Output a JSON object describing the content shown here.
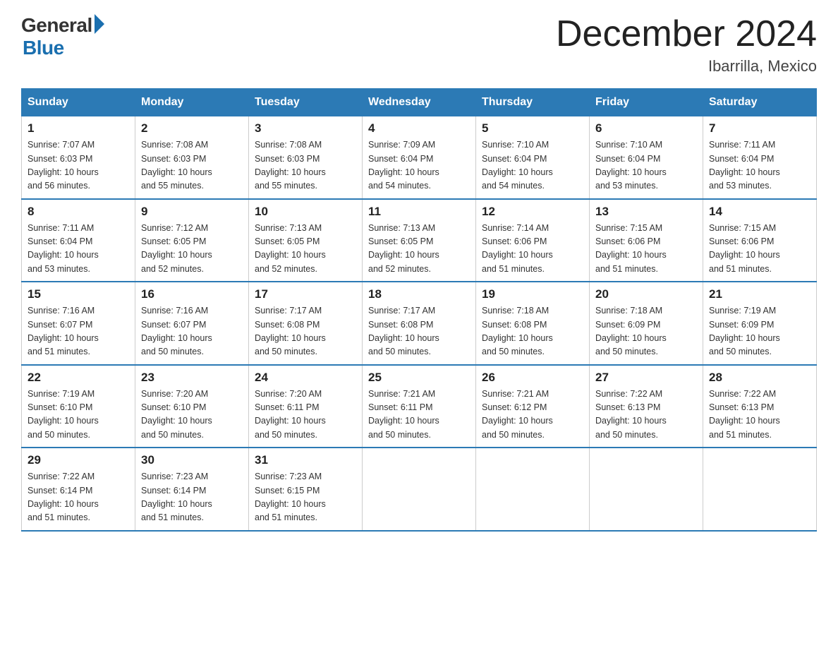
{
  "header": {
    "logo_general": "General",
    "logo_blue": "Blue",
    "title": "December 2024",
    "subtitle": "Ibarrilla, Mexico"
  },
  "days_of_week": [
    "Sunday",
    "Monday",
    "Tuesday",
    "Wednesday",
    "Thursday",
    "Friday",
    "Saturday"
  ],
  "weeks": [
    [
      {
        "day": "1",
        "sunrise": "7:07 AM",
        "sunset": "6:03 PM",
        "daylight": "10 hours and 56 minutes."
      },
      {
        "day": "2",
        "sunrise": "7:08 AM",
        "sunset": "6:03 PM",
        "daylight": "10 hours and 55 minutes."
      },
      {
        "day": "3",
        "sunrise": "7:08 AM",
        "sunset": "6:03 PM",
        "daylight": "10 hours and 55 minutes."
      },
      {
        "day": "4",
        "sunrise": "7:09 AM",
        "sunset": "6:04 PM",
        "daylight": "10 hours and 54 minutes."
      },
      {
        "day": "5",
        "sunrise": "7:10 AM",
        "sunset": "6:04 PM",
        "daylight": "10 hours and 54 minutes."
      },
      {
        "day": "6",
        "sunrise": "7:10 AM",
        "sunset": "6:04 PM",
        "daylight": "10 hours and 53 minutes."
      },
      {
        "day": "7",
        "sunrise": "7:11 AM",
        "sunset": "6:04 PM",
        "daylight": "10 hours and 53 minutes."
      }
    ],
    [
      {
        "day": "8",
        "sunrise": "7:11 AM",
        "sunset": "6:04 PM",
        "daylight": "10 hours and 53 minutes."
      },
      {
        "day": "9",
        "sunrise": "7:12 AM",
        "sunset": "6:05 PM",
        "daylight": "10 hours and 52 minutes."
      },
      {
        "day": "10",
        "sunrise": "7:13 AM",
        "sunset": "6:05 PM",
        "daylight": "10 hours and 52 minutes."
      },
      {
        "day": "11",
        "sunrise": "7:13 AM",
        "sunset": "6:05 PM",
        "daylight": "10 hours and 52 minutes."
      },
      {
        "day": "12",
        "sunrise": "7:14 AM",
        "sunset": "6:06 PM",
        "daylight": "10 hours and 51 minutes."
      },
      {
        "day": "13",
        "sunrise": "7:15 AM",
        "sunset": "6:06 PM",
        "daylight": "10 hours and 51 minutes."
      },
      {
        "day": "14",
        "sunrise": "7:15 AM",
        "sunset": "6:06 PM",
        "daylight": "10 hours and 51 minutes."
      }
    ],
    [
      {
        "day": "15",
        "sunrise": "7:16 AM",
        "sunset": "6:07 PM",
        "daylight": "10 hours and 51 minutes."
      },
      {
        "day": "16",
        "sunrise": "7:16 AM",
        "sunset": "6:07 PM",
        "daylight": "10 hours and 50 minutes."
      },
      {
        "day": "17",
        "sunrise": "7:17 AM",
        "sunset": "6:08 PM",
        "daylight": "10 hours and 50 minutes."
      },
      {
        "day": "18",
        "sunrise": "7:17 AM",
        "sunset": "6:08 PM",
        "daylight": "10 hours and 50 minutes."
      },
      {
        "day": "19",
        "sunrise": "7:18 AM",
        "sunset": "6:08 PM",
        "daylight": "10 hours and 50 minutes."
      },
      {
        "day": "20",
        "sunrise": "7:18 AM",
        "sunset": "6:09 PM",
        "daylight": "10 hours and 50 minutes."
      },
      {
        "day": "21",
        "sunrise": "7:19 AM",
        "sunset": "6:09 PM",
        "daylight": "10 hours and 50 minutes."
      }
    ],
    [
      {
        "day": "22",
        "sunrise": "7:19 AM",
        "sunset": "6:10 PM",
        "daylight": "10 hours and 50 minutes."
      },
      {
        "day": "23",
        "sunrise": "7:20 AM",
        "sunset": "6:10 PM",
        "daylight": "10 hours and 50 minutes."
      },
      {
        "day": "24",
        "sunrise": "7:20 AM",
        "sunset": "6:11 PM",
        "daylight": "10 hours and 50 minutes."
      },
      {
        "day": "25",
        "sunrise": "7:21 AM",
        "sunset": "6:11 PM",
        "daylight": "10 hours and 50 minutes."
      },
      {
        "day": "26",
        "sunrise": "7:21 AM",
        "sunset": "6:12 PM",
        "daylight": "10 hours and 50 minutes."
      },
      {
        "day": "27",
        "sunrise": "7:22 AM",
        "sunset": "6:13 PM",
        "daylight": "10 hours and 50 minutes."
      },
      {
        "day": "28",
        "sunrise": "7:22 AM",
        "sunset": "6:13 PM",
        "daylight": "10 hours and 51 minutes."
      }
    ],
    [
      {
        "day": "29",
        "sunrise": "7:22 AM",
        "sunset": "6:14 PM",
        "daylight": "10 hours and 51 minutes."
      },
      {
        "day": "30",
        "sunrise": "7:23 AM",
        "sunset": "6:14 PM",
        "daylight": "10 hours and 51 minutes."
      },
      {
        "day": "31",
        "sunrise": "7:23 AM",
        "sunset": "6:15 PM",
        "daylight": "10 hours and 51 minutes."
      },
      null,
      null,
      null,
      null
    ]
  ],
  "labels": {
    "sunrise": "Sunrise:",
    "sunset": "Sunset:",
    "daylight": "Daylight:"
  }
}
